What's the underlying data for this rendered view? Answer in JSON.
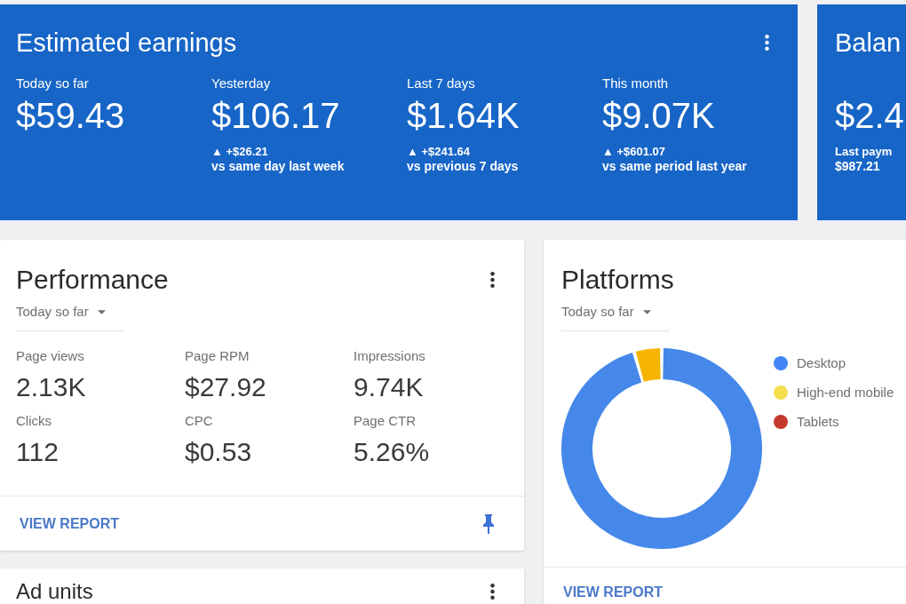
{
  "earnings_card": {
    "title": "Estimated earnings",
    "stats": [
      {
        "label": "Today so far",
        "value": "$59.43"
      },
      {
        "label": "Yesterday",
        "value": "$106.17",
        "change": "▲ +$26.21",
        "comparison": "vs same day last week"
      },
      {
        "label": "Last 7 days",
        "value": "$1.64K",
        "change": "▲ +$241.64",
        "comparison": "vs previous 7 days"
      },
      {
        "label": "This month",
        "value": "$9.07K",
        "change": "▲ +$601.07",
        "comparison": "vs same period last year"
      }
    ]
  },
  "balance_card": {
    "title": "Balan",
    "value": "$2.4",
    "note_label": "Last paym",
    "note_value": "$987.21"
  },
  "performance_card": {
    "title": "Performance",
    "period": "Today so far",
    "metrics": [
      {
        "label": "Page views",
        "value": "2.13K"
      },
      {
        "label": "Page RPM",
        "value": "$27.92"
      },
      {
        "label": "Impressions",
        "value": "9.74K"
      },
      {
        "label": "Clicks",
        "value": "112"
      },
      {
        "label": "CPC",
        "value": "$0.53"
      },
      {
        "label": "Page CTR",
        "value": "5.26%"
      }
    ],
    "footer_link": "VIEW REPORT"
  },
  "platforms_card": {
    "title": "Platforms",
    "period": "Today so far",
    "legend": [
      {
        "label": "Desktop",
        "color": "#4285f4"
      },
      {
        "label": "High-end mobile",
        "color": "#f4e04d"
      },
      {
        "label": "Tablets",
        "color": "#c5392f"
      }
    ],
    "footer_link": "VIEW REPORT"
  },
  "ad_units_card": {
    "title": "Ad units"
  }
}
